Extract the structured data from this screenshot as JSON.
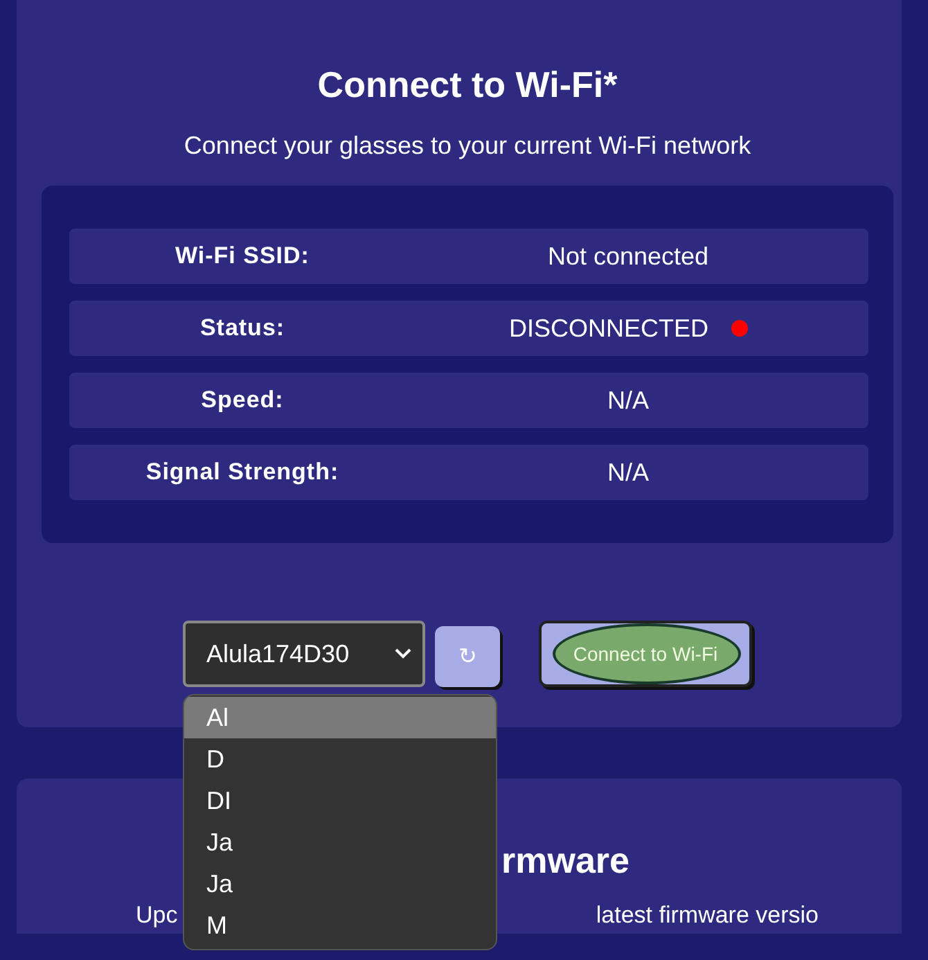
{
  "wifi_card": {
    "title": "Connect to Wi-Fi*",
    "subtitle": "Connect your glasses to your current Wi-Fi network",
    "rows": [
      {
        "label": "Wi-Fi SSID:",
        "value": "Not connected"
      },
      {
        "label": "Status:",
        "value": "DISCONNECTED",
        "color": "#ff0000"
      },
      {
        "label": "Speed:",
        "value": "N/A"
      },
      {
        "label": "Signal Strength:",
        "value": "N/A"
      }
    ],
    "network_select": {
      "value": "Alula174D30",
      "options": [
        {
          "label": "Al",
          "selected": true
        },
        {
          "label": "D",
          "selected": false
        },
        {
          "label": "DI",
          "selected": false
        },
        {
          "label": "Ja",
          "selected": false
        },
        {
          "label": "Ja",
          "selected": false
        },
        {
          "label": "M",
          "selected": false
        }
      ]
    },
    "refresh_button": "↻",
    "connect_button": "Connect to Wi-Fi"
  },
  "firmware_card": {
    "title_visible": "rmware",
    "subtitle_left": "Upc",
    "subtitle_right": "latest firmware versio"
  }
}
